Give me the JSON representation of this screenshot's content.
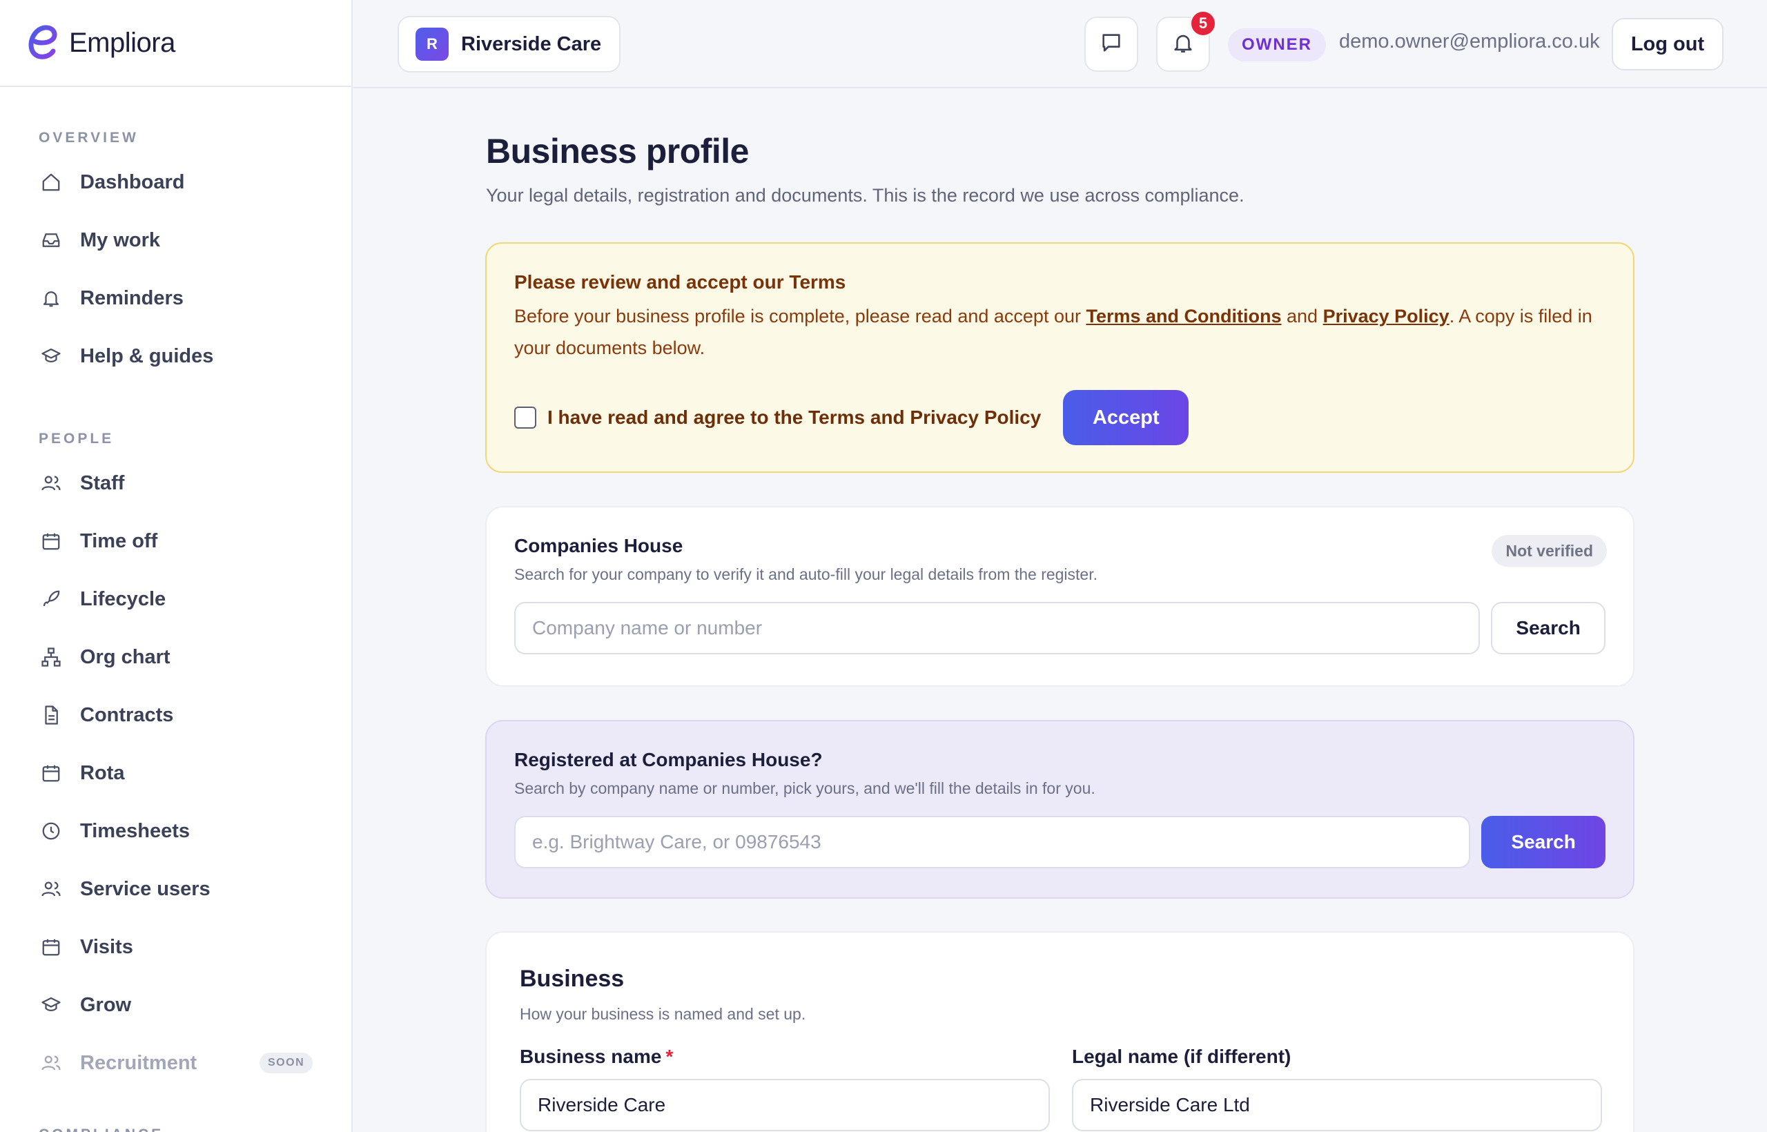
{
  "brand": {
    "name": "Empliora"
  },
  "sidebar": {
    "sections": [
      {
        "label": "OVERVIEW",
        "items": [
          {
            "label": "Dashboard",
            "icon": "home-icon"
          },
          {
            "label": "My work",
            "icon": "inbox-icon"
          },
          {
            "label": "Reminders",
            "icon": "bell-icon"
          },
          {
            "label": "Help & guides",
            "icon": "graduation-cap-icon"
          }
        ]
      },
      {
        "label": "PEOPLE",
        "items": [
          {
            "label": "Staff",
            "icon": "users-icon"
          },
          {
            "label": "Time off",
            "icon": "calendar-icon"
          },
          {
            "label": "Lifecycle",
            "icon": "rocket-icon"
          },
          {
            "label": "Org chart",
            "icon": "org-chart-icon"
          },
          {
            "label": "Contracts",
            "icon": "document-icon"
          },
          {
            "label": "Rota",
            "icon": "calendar-icon"
          },
          {
            "label": "Timesheets",
            "icon": "clock-icon"
          },
          {
            "label": "Service users",
            "icon": "users-icon"
          },
          {
            "label": "Visits",
            "icon": "calendar-icon"
          },
          {
            "label": "Grow",
            "icon": "graduation-cap-icon"
          },
          {
            "label": "Recruitment",
            "icon": "users-icon",
            "badge": "SOON"
          }
        ]
      },
      {
        "label": "COMPLIANCE",
        "items": []
      }
    ]
  },
  "header": {
    "org": {
      "initial": "R",
      "name": "Riverside Care"
    },
    "notifications_count": "5",
    "role": "OWNER",
    "email": "demo.owner@empliora.co.uk",
    "logout_label": "Log out"
  },
  "page": {
    "title": "Business profile",
    "subtitle": "Your legal details, registration and documents. This is the record we use across compliance."
  },
  "terms": {
    "title": "Please review and accept our Terms",
    "body_prefix": "Before your business profile is complete, please read and accept our ",
    "terms_link": "Terms and Conditions",
    "body_mid": " and ",
    "privacy_link": "Privacy Policy",
    "body_suffix": ". A copy is filed in your documents below.",
    "checkbox_label": "I have read and agree to the Terms and Privacy Policy",
    "accept_label": "Accept"
  },
  "companies_house": {
    "title": "Companies House",
    "status": "Not verified",
    "subtitle": "Search for your company to verify it and auto-fill your legal details from the register.",
    "placeholder": "Company name or number",
    "search_label": "Search"
  },
  "registered": {
    "title": "Registered at Companies House?",
    "subtitle": "Search by company name or number, pick yours, and we'll fill the details in for you.",
    "placeholder": "e.g. Brightway Care, or 09876543",
    "search_label": "Search"
  },
  "business": {
    "title": "Business",
    "subtitle": "How your business is named and set up.",
    "fields": [
      {
        "label": "Business name",
        "required_mark": "*",
        "value": "Riverside Care"
      },
      {
        "label": "Legal name (if different)",
        "value": "Riverside Care Ltd"
      }
    ]
  }
}
